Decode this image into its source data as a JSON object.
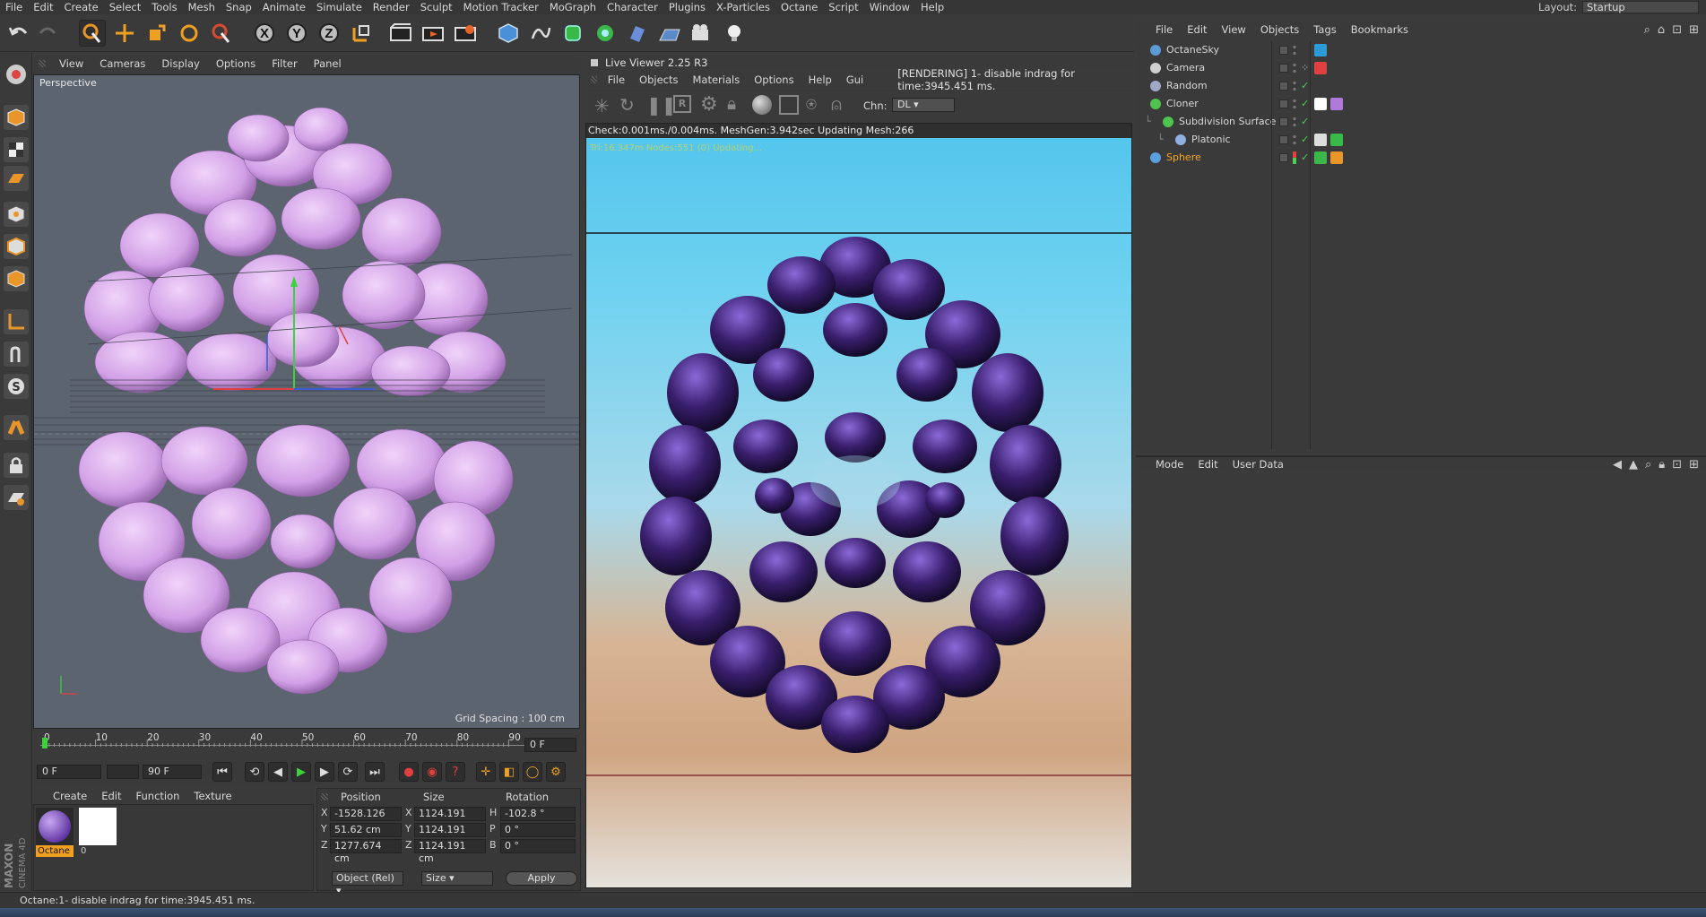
{
  "menubar": {
    "items": [
      "File",
      "Edit",
      "Create",
      "Select",
      "Tools",
      "Mesh",
      "Snap",
      "Animate",
      "Simulate",
      "Render",
      "Sculpt",
      "Motion Tracker",
      "MoGraph",
      "Character",
      "Plugins",
      "X-Particles",
      "Octane",
      "Script",
      "Window",
      "Help"
    ],
    "layout_label": "Layout:",
    "layout_value": "Startup"
  },
  "viewport": {
    "menu": [
      "View",
      "Cameras",
      "Display",
      "Options",
      "Filter",
      "Panel"
    ],
    "label": "Perspective",
    "grid_spacing": "Grid Spacing : 100 cm"
  },
  "timeline": {
    "ticks": [
      "0",
      "10",
      "20",
      "30",
      "40",
      "50",
      "60",
      "70",
      "80",
      "90"
    ],
    "current_frame": "0 F",
    "start_field": "0 F",
    "end_field": "90 F"
  },
  "material_panel": {
    "menu": [
      "Create",
      "Edit",
      "Function",
      "Texture"
    ],
    "materials": [
      {
        "name": "Octane"
      },
      {
        "name": "0"
      }
    ]
  },
  "coordinates": {
    "headers": [
      "Position",
      "Size",
      "Rotation"
    ],
    "rows": [
      {
        "axis": "X",
        "position": "-1528.126 cm",
        "size_axis": "X",
        "size": "1124.191 cm",
        "rot_axis": "H",
        "rotation": "-102.8 °"
      },
      {
        "axis": "Y",
        "position": "51.62 cm",
        "size_axis": "Y",
        "size": "1124.191 cm",
        "rot_axis": "P",
        "rotation": "0 °"
      },
      {
        "axis": "Z",
        "position": "1277.674 cm",
        "size_axis": "Z",
        "size": "1124.191 cm",
        "rot_axis": "B",
        "rotation": "0 °"
      }
    ],
    "mode_select": "Object (Rel)",
    "size_select": "Size",
    "apply_label": "Apply"
  },
  "live_viewer": {
    "title": "Live Viewer 2.25 R3",
    "menu": [
      "File",
      "Objects",
      "Materials",
      "Options",
      "Help",
      "Gui"
    ],
    "rendering_status": "[RENDERING] 1- disable indrag for time:3945.451 ms.",
    "channel_label": "Chn:",
    "channel_value": "DL",
    "mesh_info": "Check:0.001ms./0.004ms. MeshGen:3.942sec Updating Mesh:266",
    "updating_info": "Tri:16.347m Nodes:551 (0) Updating..."
  },
  "object_manager": {
    "menu": [
      "File",
      "Edit",
      "View",
      "Objects",
      "Tags",
      "Bookmarks"
    ],
    "objects": [
      {
        "name": "OctaneSky",
        "color": "#5a9bd8",
        "indent": 0,
        "selected": false
      },
      {
        "name": "Camera",
        "color": "#cfcfcf",
        "indent": 0,
        "selected": false
      },
      {
        "name": "Random",
        "color": "#9fa9c4",
        "indent": 0,
        "selected": false
      },
      {
        "name": "Cloner",
        "color": "#4fc24f",
        "indent": 0,
        "selected": false
      },
      {
        "name": "Subdivision Surface",
        "color": "#4fc24f",
        "indent": 1,
        "selected": false
      },
      {
        "name": "Platonic",
        "color": "#8fb0e0",
        "indent": 2,
        "selected": false
      },
      {
        "name": "Sphere",
        "color": "#5aa0e0",
        "indent": 0,
        "selected": true
      }
    ]
  },
  "attribute_manager": {
    "menu": [
      "Mode",
      "Edit",
      "User Data"
    ]
  },
  "statusbar": {
    "text": "Octane:1- disable indrag for time:3945.451 ms."
  },
  "colors": {
    "accent_orange": "#f0a020",
    "selected_object": "#f5a623",
    "check_green": "#4cd14c",
    "viewport_bg": "#5c6470",
    "blob_pink": "#d7a9e8",
    "render_purple": "#3a1f6e"
  },
  "logo": {
    "text": "MAXON CINEMA 4D"
  }
}
